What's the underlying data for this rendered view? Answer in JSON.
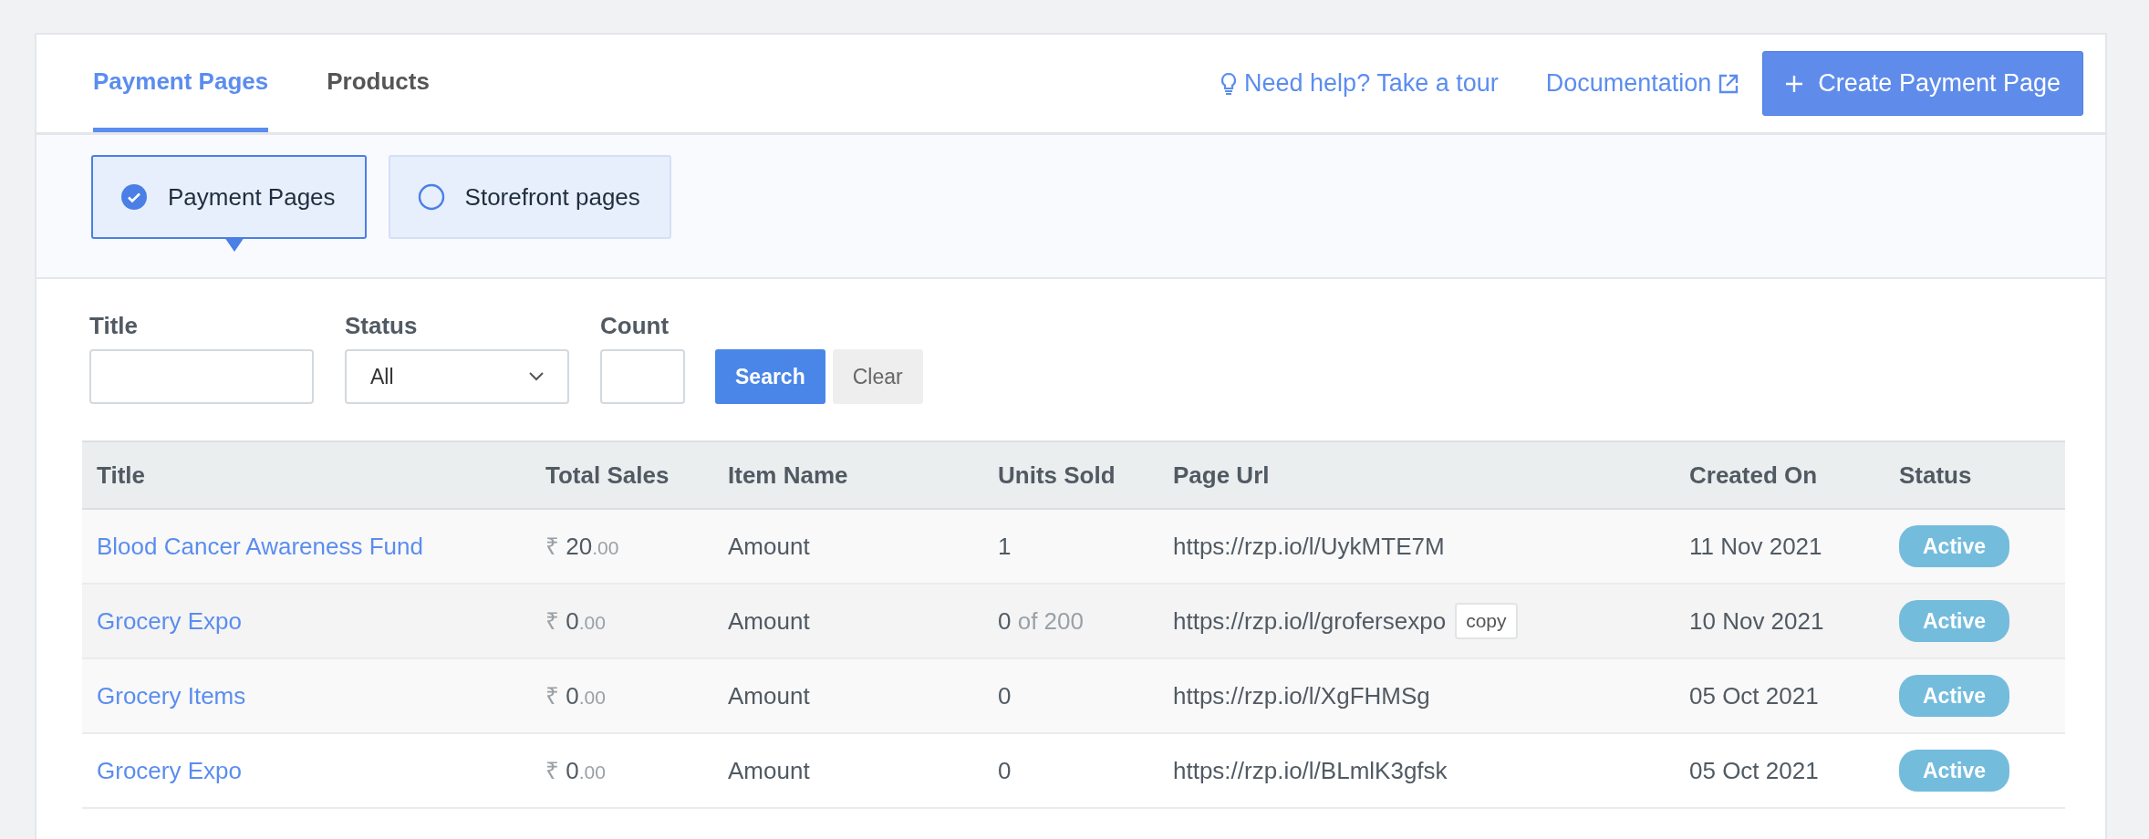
{
  "tabs": [
    {
      "label": "Payment Pages",
      "selected": true
    },
    {
      "label": "Products",
      "selected": false
    }
  ],
  "header_actions": {
    "tour_link": "Need help? Take a tour",
    "docs_link": "Documentation",
    "create_button": "Create Payment Page"
  },
  "page_types": [
    {
      "label": "Payment Pages",
      "selected": true
    },
    {
      "label": "Storefront pages",
      "selected": false
    }
  ],
  "filters": {
    "title": {
      "label": "Title"
    },
    "status": {
      "label": "Status",
      "value": "All"
    },
    "count": {
      "label": "Count"
    },
    "search_button": "Search",
    "clear_button": "Clear"
  },
  "table": {
    "columns": [
      "Title",
      "Total Sales",
      "Item Name",
      "Units Sold",
      "Page Url",
      "Created On",
      "Status"
    ],
    "rows": [
      {
        "title": "Blood Cancer Awareness Fund",
        "currency": "₹",
        "amount": "20",
        "decimals": ".00",
        "item": "Amount",
        "units": "1",
        "url": "https://rzp.io/l/UykMTE7M",
        "created": "11 Nov 2021",
        "status": "Active"
      },
      {
        "title": "Grocery Expo",
        "currency": "₹",
        "amount": "0",
        "decimals": ".00",
        "item": "Amount",
        "units": "0",
        "units_of": "of 200",
        "url": "https://rzp.io/l/grofersexpo",
        "copy": "copy",
        "created": "10 Nov 2021",
        "status": "Active"
      },
      {
        "title": "Grocery Items",
        "currency": "₹",
        "amount": "0",
        "decimals": ".00",
        "item": "Amount",
        "units": "0",
        "url": "https://rzp.io/l/XgFHMSg",
        "created": "05 Oct 2021",
        "status": "Active"
      },
      {
        "title": "Grocery Expo",
        "currency": "₹",
        "amount": "0",
        "decimals": ".00",
        "item": "Amount",
        "units": "0",
        "url": "https://rzp.io/l/BLmlK3gfsk",
        "created": "05 Oct 2021",
        "status": "Active"
      }
    ]
  }
}
